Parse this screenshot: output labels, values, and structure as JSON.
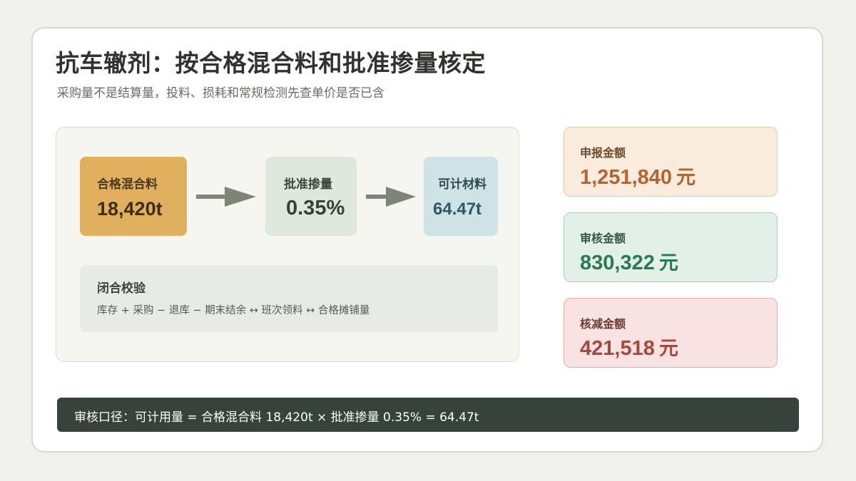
{
  "header": {
    "title": "抗车辙剂：按合格混合料和批准掺量核定",
    "subtitle": "采购量不是结算量，投料、损耗和常规检测先查单价是否已含"
  },
  "flow": {
    "mix": {
      "label": "合格混合料",
      "value": "18,420t"
    },
    "rate": {
      "label": "批准掺量",
      "value": "0.35%"
    },
    "billable": {
      "label": "可计材料",
      "value": "64.47t"
    }
  },
  "closure": {
    "heading": "闭合校验",
    "formula": "库存 + 采购 − 退库 − 期末结余 ↔ 班次领料 ↔ 合格摊铺量"
  },
  "amounts": {
    "declared": {
      "label": "申报金额",
      "value": "1,251,840",
      "unit": "元"
    },
    "approved": {
      "label": "审核金额",
      "value": "830,322",
      "unit": "元"
    },
    "reduced": {
      "label": "核减金额",
      "value": "421,518",
      "unit": "元"
    }
  },
  "footer": {
    "text": "审核口径：可计用量 = 合格混合料 18,420t × 批准掺量 0.35% = 64.47t"
  },
  "icons": {
    "arrow": "right-arrow-icon"
  },
  "colors": {
    "background": "#f1f1ec",
    "mix_box": "#e0b05f",
    "rate_box": "#dfe8dd",
    "billable_box": "#cfe2e6",
    "declared": "#b4642e",
    "approved": "#287a52",
    "reduced": "#a8483a",
    "footer_bar": "#36423a"
  }
}
